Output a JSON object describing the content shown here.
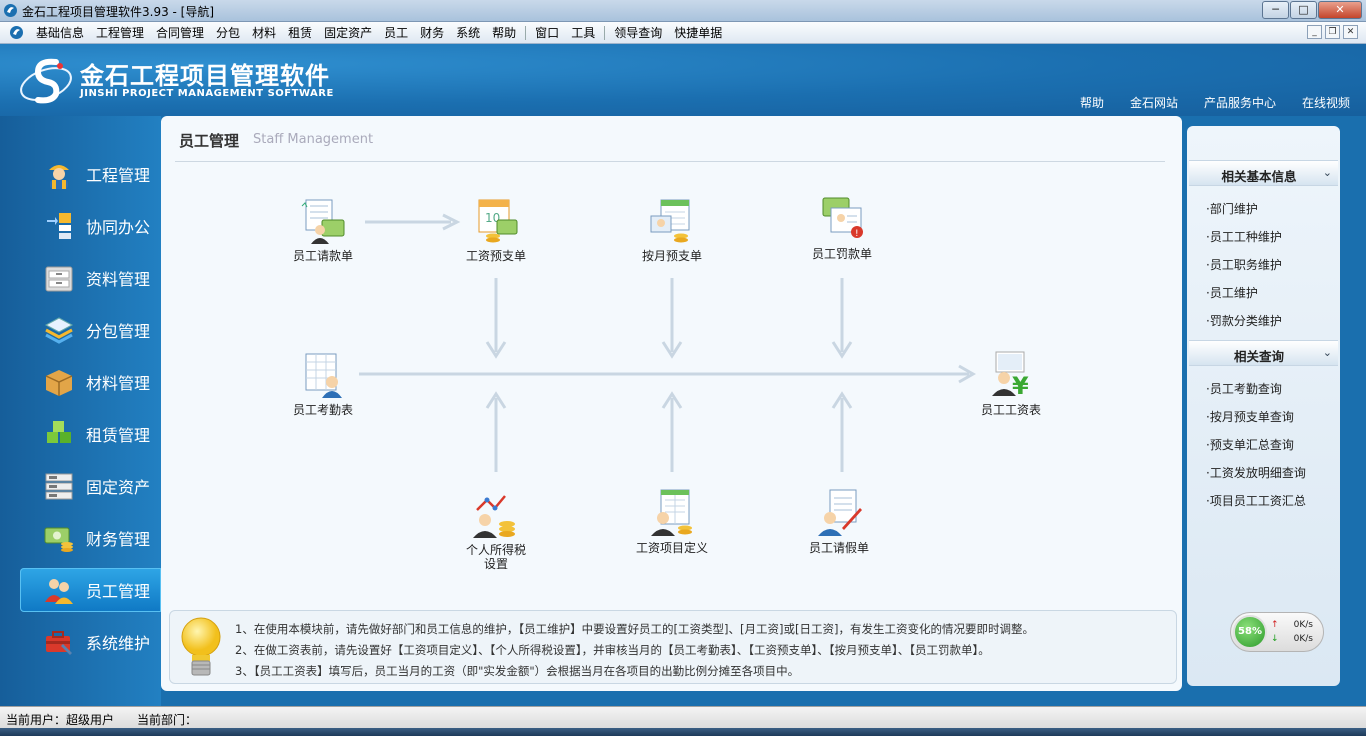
{
  "window": {
    "title": "金石工程项目管理软件3.93 - [导航]",
    "minimize": "─",
    "maximize": "□",
    "close": "✕"
  },
  "menubar": {
    "items": [
      "基础信息",
      "工程管理",
      "合同管理",
      "分包",
      "材料",
      "租赁",
      "固定资产",
      "员工",
      "财务",
      "系统",
      "帮助",
      "窗口",
      "工具",
      "领导查询",
      "快捷单据"
    ],
    "mdi_min": "_",
    "mdi_restore": "❐",
    "mdi_close": "✕"
  },
  "header": {
    "logo_cn": "金石工程项目管理软件",
    "logo_en": "JINSHI PROJECT MANAGEMENT SOFTWARE",
    "links": [
      "帮助",
      "金石网站",
      "产品服务中心",
      "在线视频"
    ]
  },
  "nav": {
    "items": [
      "工程管理",
      "协同办公",
      "资料管理",
      "分包管理",
      "材料管理",
      "租赁管理",
      "固定资产",
      "财务管理",
      "员工管理",
      "系统维护"
    ],
    "active": "员工管理"
  },
  "main": {
    "title": "员工管理",
    "subtitle": "Staff Management",
    "nodes": {
      "loan": "员工请款单",
      "advance": "工资预支单",
      "monthly_advance": "按月预支单",
      "penalty": "员工罚款单",
      "attendance": "员工考勤表",
      "payroll": "员工工资表",
      "tax_line1": "个人所得税",
      "tax_line2": "设置",
      "items": "工资项目定义",
      "leave": "员工请假单"
    },
    "tips": [
      "1、在使用本模块前，请先做好部门和员工信息的维护，【员工维护】中要设置好员工的[工资类型]、[月工资]或[日工资]，有发生工资变化的情况要即时调整。",
      "2、在做工资表前，请先设置好【工资项目定义】、【个人所得税设置】，并审核当月的【员工考勤表】、【工资预支单】、【按月预支单】、【员工罚款单】。",
      "3、【员工工资表】填写后，员工当月的工资（即\"实发金额\"）会根据当月在各项目的出勤比例分摊至各项目中。"
    ]
  },
  "right": {
    "section1": {
      "title": "相关基本信息",
      "items": [
        "·部门维护",
        "·员工工种维护",
        "·员工职务维护",
        "·员工维护",
        "·罚款分类维护"
      ]
    },
    "section2": {
      "title": "相关查询",
      "items": [
        "·员工考勤查询",
        "·按月预支单查询",
        "·预支单汇总查询",
        "·工资发放明细查询",
        "·项目员工工资汇总"
      ]
    },
    "chevron": "⌄"
  },
  "netmeter": {
    "percent_text": "58%",
    "up_rate": "0K/s",
    "down_rate": "0K/s",
    "up_arrow": "↑",
    "down_arrow": "↓"
  },
  "status": {
    "user": "当前用户：超级用户",
    "dept": "当前部门："
  },
  "colors": {
    "accent": "#1b6fb0",
    "nav_active": "#1f8fd8"
  }
}
